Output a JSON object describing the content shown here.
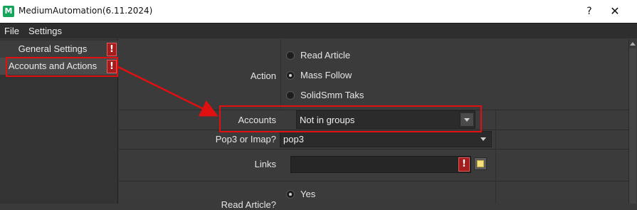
{
  "window": {
    "title": "MediumAutomation(6.11.2024)",
    "app_icon_letter": "M",
    "help_label": "?",
    "close_label": "✕"
  },
  "menu": {
    "items": [
      "File",
      "Settings"
    ]
  },
  "sidebar": {
    "items": [
      {
        "label": "General Settings",
        "alert": "!"
      },
      {
        "label": "Accounts and Actions",
        "alert": "!"
      }
    ]
  },
  "form": {
    "action": {
      "label": "Action",
      "options": [
        "Read Article",
        "Mass Follow",
        "SolidSmm Taks"
      ],
      "selected": "Mass Follow"
    },
    "accounts": {
      "label": "Accounts",
      "value": "Not in groups"
    },
    "pop3": {
      "label": "Pop3 or Imap?",
      "value": "pop3"
    },
    "links": {
      "label": "Links",
      "value": "",
      "alert": "!"
    },
    "read_article": {
      "label": "Read Article?",
      "option_yes": "Yes"
    }
  },
  "colors": {
    "highlight": "#e01010",
    "alert_bg": "#a51c1c",
    "app_icon": "#17a45c"
  }
}
